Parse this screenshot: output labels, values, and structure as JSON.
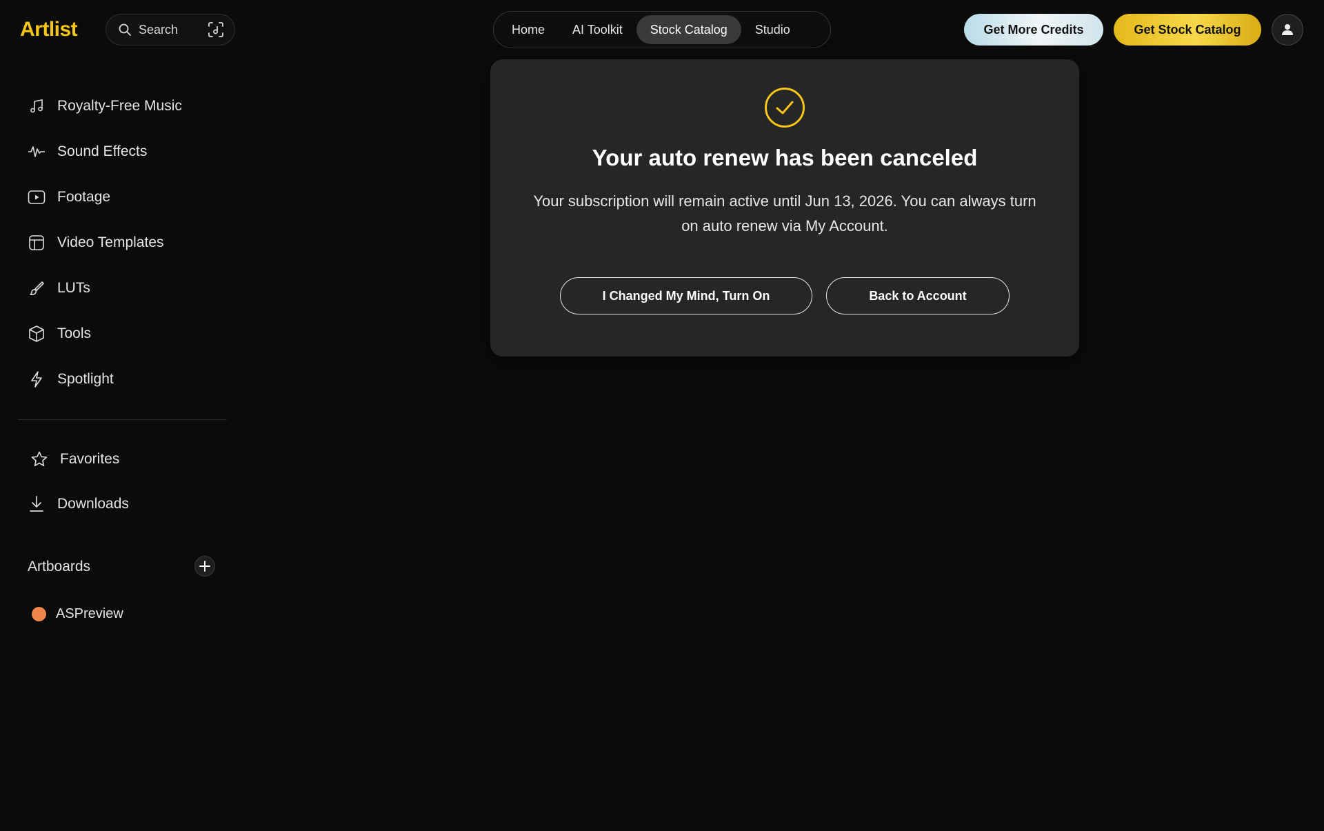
{
  "header": {
    "logo": "Artlist",
    "search_label": "Search",
    "tabs": [
      {
        "label": "Home",
        "active": false
      },
      {
        "label": "AI Toolkit",
        "active": false
      },
      {
        "label": "Stock Catalog",
        "active": true
      },
      {
        "label": "Studio",
        "active": false
      }
    ],
    "credits_button": "Get More Credits",
    "stock_button": "Get Stock Catalog"
  },
  "sidebar": {
    "items": [
      {
        "label": "Royalty-Free Music",
        "icon": "music-note-icon"
      },
      {
        "label": "Sound Effects",
        "icon": "waveform-icon"
      },
      {
        "label": "Footage",
        "icon": "play-box-icon"
      },
      {
        "label": "Video Templates",
        "icon": "template-icon"
      },
      {
        "label": "LUTs",
        "icon": "brush-icon"
      },
      {
        "label": "Tools",
        "icon": "cube-icon"
      },
      {
        "label": "Spotlight",
        "icon": "lightning-icon"
      }
    ],
    "secondary": [
      {
        "label": "Favorites",
        "icon": "star-icon"
      },
      {
        "label": "Downloads",
        "icon": "download-icon"
      }
    ],
    "artboards_label": "Artboards",
    "artboards": [
      {
        "label": "ASPreview",
        "color": "#f0874a"
      }
    ]
  },
  "modal": {
    "title": "Your auto renew has been canceled",
    "body": "Your subscription will remain active until Jun 13, 2026. You can always turn on auto renew via My Account.",
    "turn_on_button": "I Changed My Mind, Turn On",
    "back_button": "Back to Account",
    "accent": "#f5c518"
  }
}
